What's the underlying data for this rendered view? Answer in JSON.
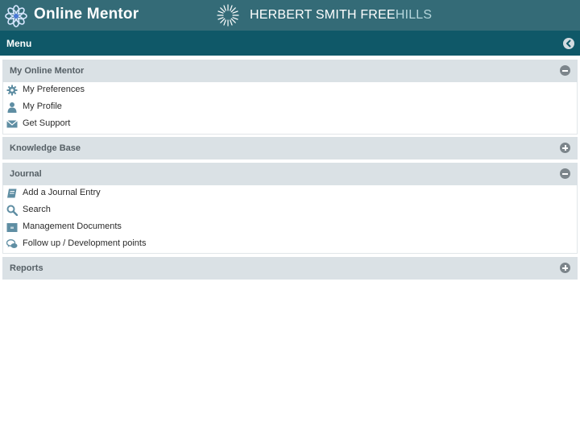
{
  "header": {
    "app_title": "Online Mentor",
    "firm_name_main": "HERBERT SMITH FREE",
    "firm_name_tail": "HILLS"
  },
  "menu": {
    "label": "Menu"
  },
  "sections": [
    {
      "title": "My Online Mentor",
      "expanded": true,
      "items": [
        {
          "label": "My Preferences",
          "icon": "gear-icon"
        },
        {
          "label": "My Profile",
          "icon": "person-icon"
        },
        {
          "label": "Get Support",
          "icon": "envelope-icon"
        }
      ]
    },
    {
      "title": "Knowledge Base",
      "expanded": false
    },
    {
      "title": "Journal",
      "expanded": true,
      "items": [
        {
          "label": "Add a Journal Entry",
          "icon": "notebook-icon"
        },
        {
          "label": "Search",
          "icon": "search-icon"
        },
        {
          "label": "Management Documents",
          "icon": "briefcase-icon"
        },
        {
          "label": "Follow up / Development points",
          "icon": "chat-bubbles-icon"
        }
      ]
    },
    {
      "title": "Reports",
      "expanded": false
    }
  ],
  "colors": {
    "header_bg": "#346b77",
    "menu_bar_bg": "#0f5868",
    "section_header_bg": "#dae1e5",
    "icon_color": "#5f8ea3"
  }
}
